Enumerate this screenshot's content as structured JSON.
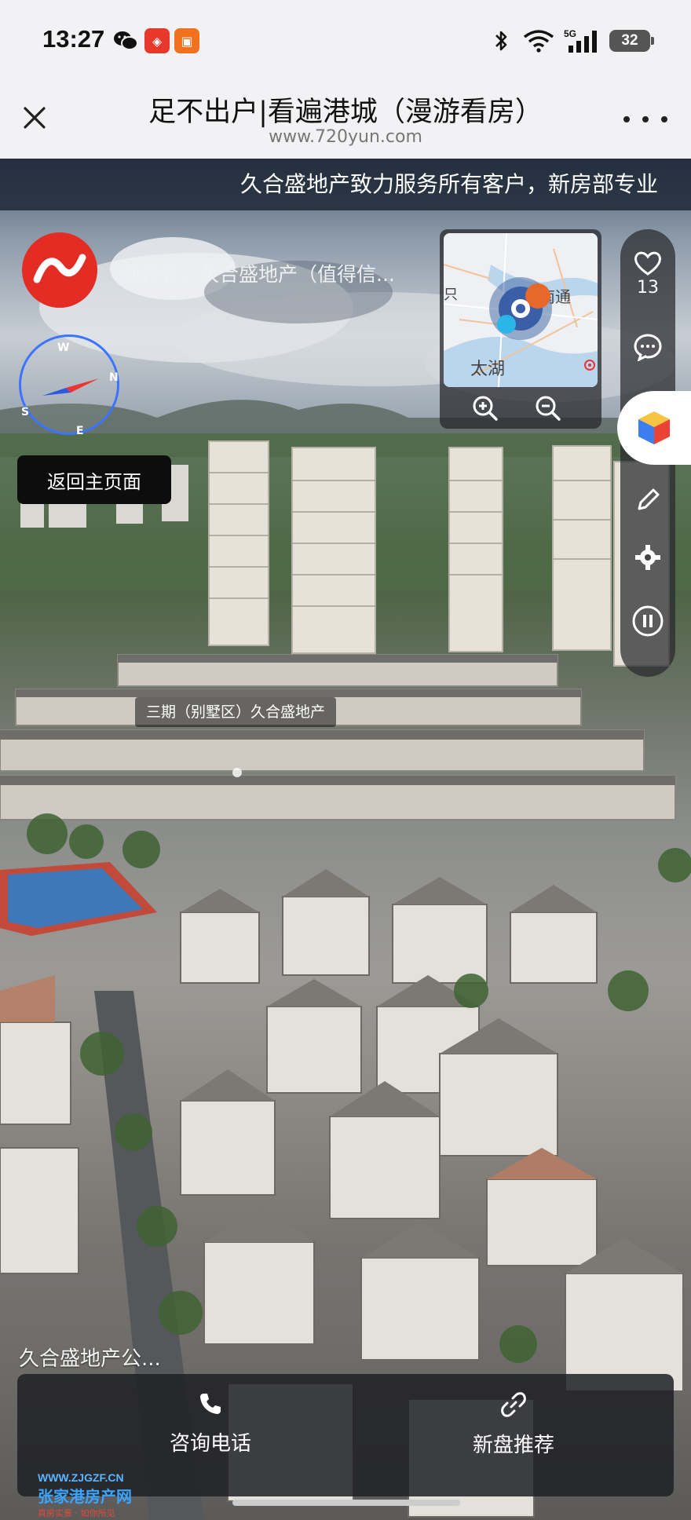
{
  "status_bar": {
    "time": "13:27",
    "network": "5G",
    "battery": "32",
    "app_badges": [
      "wechat-icon",
      "app-badge-red",
      "app-badge-orange"
    ]
  },
  "nav": {
    "title": "足不出户|看遍港城（漫游看房）",
    "url": "www.720yun.com"
  },
  "pano": {
    "marquee": "久合盛地产致力服务所有客户，新房部专业",
    "creator": "创作者：久合盛地产（值得信...",
    "home_button": "返回主页面",
    "compass": {
      "N": "N",
      "S": "S",
      "E": "E",
      "W": "W"
    },
    "minimap": {
      "labels": [
        "南通",
        "太湖"
      ],
      "partial_label": "只"
    },
    "like_count": "13",
    "hotspot_label": "三期（别墅区）久合盛地产",
    "bottom_caption": "久合盛地产公..."
  },
  "actions": {
    "call_label": "咨询电话",
    "recommend_label": "新盘推荐"
  },
  "watermark": {
    "url": "WWW.ZJGZF.CN",
    "name": "张家港房产网",
    "slogan": "真房实景 · 如你所见"
  },
  "colors": {
    "accent_blue": "#3b74ff",
    "logo_red": "#e22c24"
  }
}
